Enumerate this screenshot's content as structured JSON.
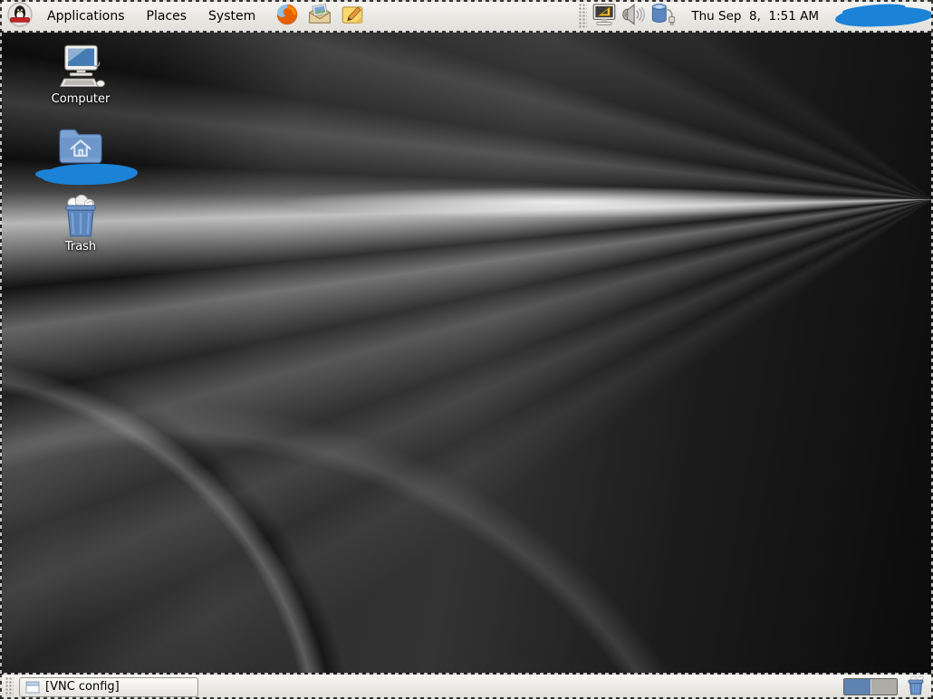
{
  "top_panel": {
    "menus": [
      {
        "label": "Applications"
      },
      {
        "label": "Places"
      },
      {
        "label": "System"
      }
    ],
    "launchers": [
      {
        "name": "firefox",
        "icon": "firefox-icon"
      },
      {
        "name": "email",
        "icon": "email-icon"
      },
      {
        "name": "notes",
        "icon": "notes-icon"
      }
    ],
    "tray_icons": [
      {
        "name": "display-settings",
        "icon": "display-settings-icon"
      },
      {
        "name": "volume",
        "icon": "speaker-icon"
      },
      {
        "name": "power",
        "icon": "battery-plug-icon"
      }
    ],
    "clock": "Thu Sep  8,  1:51 AM",
    "menu_logo_icon": "linux-penguin-badge-icon"
  },
  "desktop": {
    "icons": [
      {
        "label": "Computer",
        "icon": "computer-icon"
      },
      {
        "label": "",
        "icon": "home-folder-icon",
        "redacted": true
      },
      {
        "label": "Trash",
        "icon": "trash-icon"
      }
    ]
  },
  "bottom_panel": {
    "window_buttons": [
      {
        "label": "[VNC config]",
        "icon": "window-icon"
      }
    ],
    "workspace_switcher": {
      "count": 2,
      "active_index": 0
    },
    "trash_applet_icon": "trash-icon"
  },
  "redactions": [
    {
      "location": "top-panel-right"
    },
    {
      "location": "home-icon-label"
    }
  ],
  "colors": {
    "panel_bg": "#edebe6",
    "redaction_blue": "#1b82d6",
    "workspace_active": "#5f83b0",
    "workspace_inactive": "#aeaca7",
    "desktop_base": "#101010"
  }
}
